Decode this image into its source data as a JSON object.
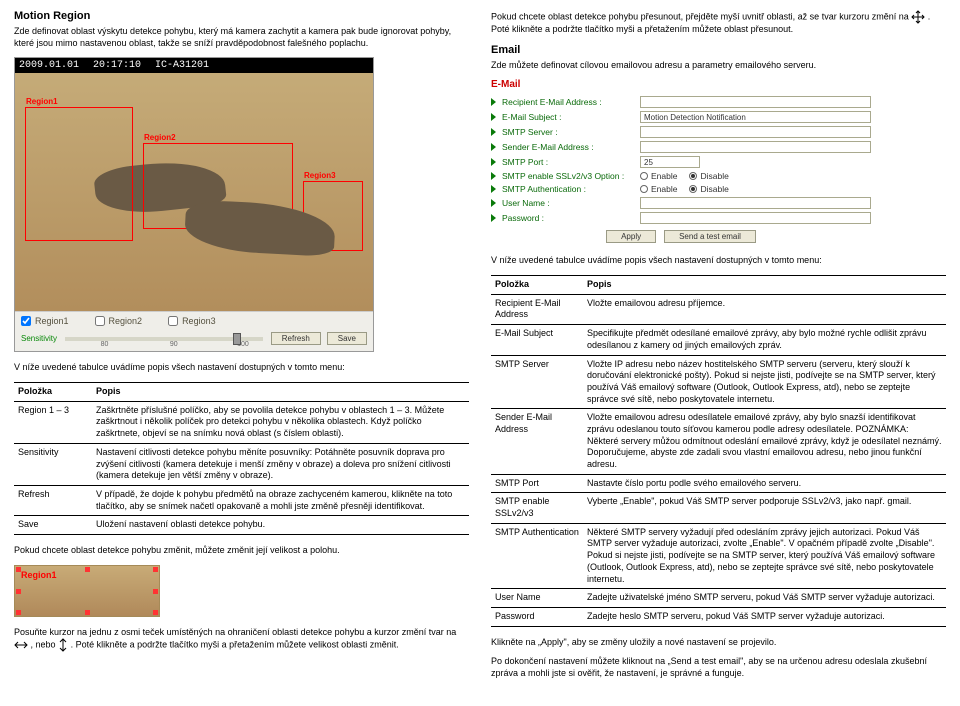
{
  "left": {
    "heading": "Motion Region",
    "intro": "Zde definovat oblast výskytu detekce pohybu, který má kamera zachytit a kamera pak bude ignorovat pohyby, které jsou mimo nastavenou oblast, takže se sníží pravděpodobnost falešného poplachu.",
    "cam": {
      "date": "2009.01.01",
      "time": "20:17:10",
      "id": "IC-A31201",
      "region1": "Region1",
      "region2": "Region2",
      "region3": "Region3",
      "cb1": "Region1",
      "cb2": "Region2",
      "cb3": "Region3",
      "sensitivity": "Sensitivity",
      "t80": "80",
      "t90": "90",
      "t100": "100",
      "refresh": "Refresh",
      "save": "Save"
    },
    "table_intro": "V níže uvedené tabulce uvádíme popis všech nastavení dostupných v tomto menu:",
    "th1": "Položka",
    "th2": "Popis",
    "rows": [
      {
        "k": "Region 1 – 3",
        "v": "Zaškrtněte příslušné políčko, aby se povolila detekce pohybu v oblastech 1 – 3. Můžete zaškrtnout i několik políček pro detekci pohybu v několika oblastech. Když políčko zaškrtnete, objeví se na snímku nová oblast (s číslem oblasti)."
      },
      {
        "k": "Sensitivity",
        "v": "Nastavení citlivosti detekce pohybu měníte posuvníky: Potáhněte posuvník doprava pro zvýšení citlivosti (kamera detekuje i menší změny v obraze) a doleva pro snížení citlivosti (kamera detekuje jen větší změny v obraze)."
      },
      {
        "k": "Refresh",
        "v": "V případě, že dojde k pohybu předmětů na obraze zachyceném kamerou, klikněte na toto tlačítko, aby se snímek načetl opakovaně a mohli jste změně přesněji identifikovat."
      },
      {
        "k": "Save",
        "v": "Uložení nastavení oblasti detekce pohybu."
      }
    ],
    "change_note": "Pokud chcete oblast detekce pohybu změnit, můžete změnit její velikost a polohu.",
    "strip_label": "Region1",
    "resize_1": "Posuňte kurzor na jednu z osmi teček umístěných na ohraničení oblasti detekce pohybu a kurzor změní tvar na ",
    "resize_mid": ", nebo ",
    "resize_2": ". Poté klikněte a podržte tlačítko myši a přetažením můžete velikost oblasti změnit."
  },
  "right": {
    "move_1": "Pokud chcete oblast detekce pohybu přesunout, přejděte myší uvnitř oblasti, až se tvar kurzoru změní na ",
    "move_2": ". Poté klikněte a podržte tlačítko myši a přetažením můžete oblast přesunout.",
    "email_h": "Email",
    "email_p": "Zde můžete definovat cílovou emailovou adresu a parametry emailového serveru.",
    "form": {
      "title": "E-Mail",
      "recipient": "Recipient E-Mail Address :",
      "subject": "E-Mail Subject :",
      "subject_val": "Motion Detection Notification",
      "smtp": "SMTP Server :",
      "sender": "Sender E-Mail Address :",
      "port": "SMTP Port :",
      "port_val": "25",
      "ssl": "SMTP enable SSLv2/v3 Option :",
      "auth": "SMTP Authentication :",
      "user": "User Name :",
      "pass": "Password :",
      "enable": "Enable",
      "disable": "Disable",
      "apply": "Apply",
      "test": "Send a test email"
    },
    "table_intro": "V níže uvedené tabulce uvádíme popis všech nastavení dostupných v tomto menu:",
    "th1": "Položka",
    "th2": "Popis",
    "rows": [
      {
        "k": "Recipient E-Mail Address",
        "v": "Vložte emailovou adresu příjemce."
      },
      {
        "k": "E-Mail Subject",
        "v": "Specifikujte předmět odesílané emailové zprávy, aby bylo možné rychle odlišit zprávu odesílanou z kamery od jiných emailových zpráv."
      },
      {
        "k": "SMTP Server",
        "v": "Vložte IP adresu nebo název hostitelského SMTP serveru (serveru, který slouží k doručování elektronické pošty). Pokud si nejste jisti, podívejte se na SMTP server, který používá Váš emailový software (Outlook, Outlook Express, atd), nebo se zeptejte správce své sítě, nebo poskytovatele internetu."
      },
      {
        "k": "Sender E-Mail Address",
        "v": "Vložte emailovou adresu odesílatele emailové zprávy, aby bylo snazší identifikovat zprávu odeslanou touto síťovou kamerou podle adresy odesílatele. POZNÁMKA: Některé servery můžou odmítnout odeslání emailové zprávy, když je odesílatel neznámý. Doporučujeme, abyste zde zadali svou vlastní emailovou adresu, nebo jinou funkční adresu."
      },
      {
        "k": "SMTP Port",
        "v": "Nastavte číslo portu podle svého emailového serveru."
      },
      {
        "k": "SMTP enable SSLv2/v3",
        "v": "Vyberte „Enable\", pokud Váš SMTP server podporuje SSLv2/v3, jako např. gmail."
      },
      {
        "k": "SMTP Authentication",
        "v": "Některé SMTP servery vyžadují před odesláním zprávy jejich autorizaci. Pokud Váš SMTP server vyžaduje autorizaci, zvolte „Enable\". V opačném případě zvolte „Disable\". Pokud si nejste jisti, podívejte se na SMTP server, který používá Váš emailový software (Outlook, Outlook Express, atd), nebo se zeptejte správce své sítě, nebo poskytovatele internetu."
      },
      {
        "k": "User Name",
        "v": "Zadejte uživatelské jméno SMTP serveru, pokud Váš SMTP server vyžaduje autorizaci."
      },
      {
        "k": "Password",
        "v": "Zadejte heslo SMTP serveru, pokud Váš SMTP server vyžaduje autorizaci."
      }
    ],
    "apply_note": "Klikněte na „Apply\", aby se změny uložily a nové nastavení se projevilo.",
    "test_note": "Po dokončení nastavení můžete kliknout na „Send a test email\", aby se na určenou adresu odeslala zkušební zpráva a mohli jste si ověřit, že nastavení, je správné a funguje."
  }
}
